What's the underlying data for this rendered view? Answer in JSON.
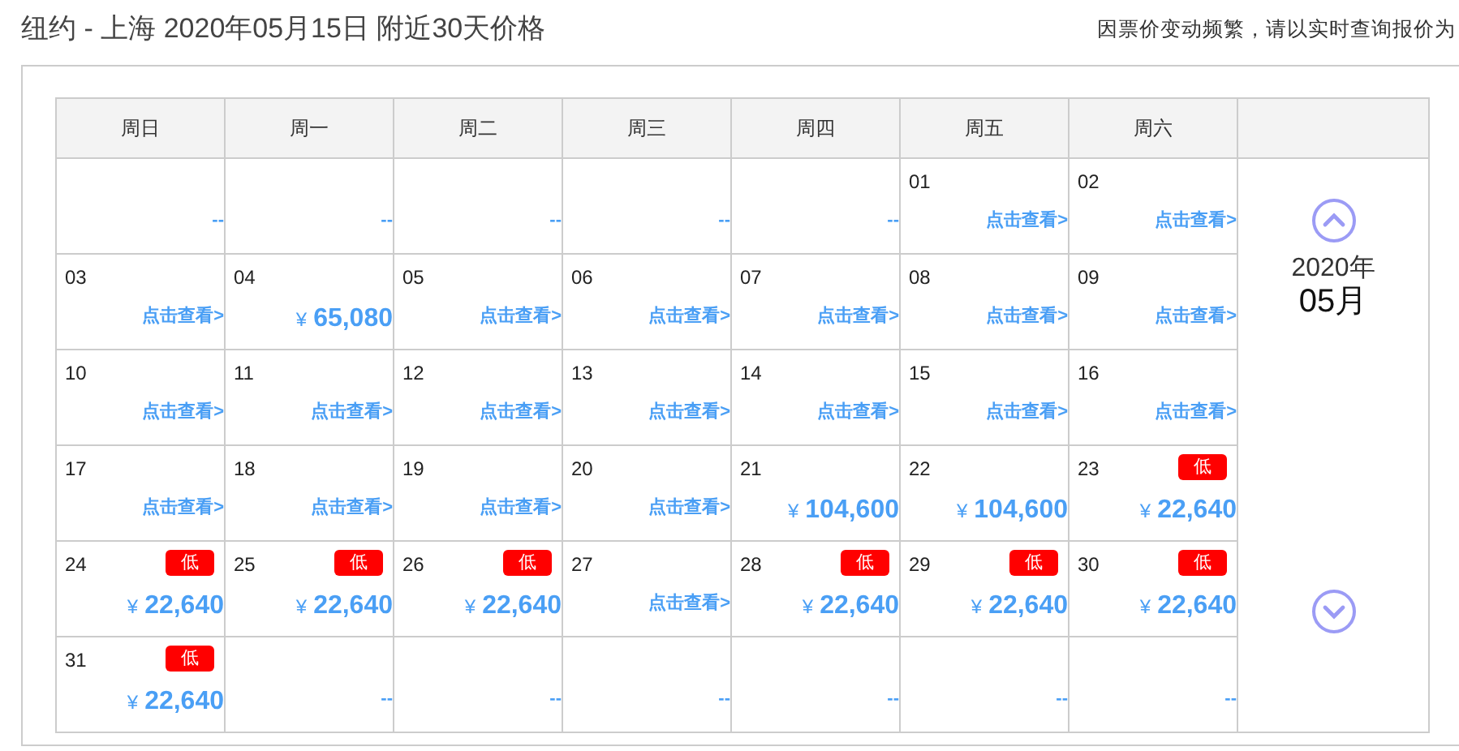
{
  "header": {
    "title": "纽约 - 上海 2020年05月15日  附近30天价格",
    "notice": "因票价变动频繁，请以实时查询报价为"
  },
  "weekdays": [
    "周日",
    "周一",
    "周二",
    "周三",
    "周四",
    "周五",
    "周六"
  ],
  "weeks": [
    [
      {
        "kind": "empty",
        "text": "--"
      },
      {
        "kind": "empty",
        "text": "--"
      },
      {
        "kind": "empty",
        "text": "--"
      },
      {
        "kind": "empty",
        "text": "--"
      },
      {
        "kind": "empty",
        "text": "--"
      },
      {
        "kind": "view",
        "date": "01",
        "link": "点击查看>"
      },
      {
        "kind": "view",
        "date": "02",
        "link": "点击查看>"
      }
    ],
    [
      {
        "kind": "view",
        "date": "03",
        "link": "点击查看>"
      },
      {
        "kind": "price",
        "date": "04",
        "currency": "¥",
        "price": "65,080"
      },
      {
        "kind": "view",
        "date": "05",
        "link": "点击查看>"
      },
      {
        "kind": "view",
        "date": "06",
        "link": "点击查看>"
      },
      {
        "kind": "view",
        "date": "07",
        "link": "点击查看>"
      },
      {
        "kind": "view",
        "date": "08",
        "link": "点击查看>"
      },
      {
        "kind": "view",
        "date": "09",
        "link": "点击查看>"
      }
    ],
    [
      {
        "kind": "view",
        "date": "10",
        "link": "点击查看>"
      },
      {
        "kind": "view",
        "date": "11",
        "link": "点击查看>"
      },
      {
        "kind": "view",
        "date": "12",
        "link": "点击查看>"
      },
      {
        "kind": "view",
        "date": "13",
        "link": "点击查看>"
      },
      {
        "kind": "view",
        "date": "14",
        "link": "点击查看>"
      },
      {
        "kind": "view",
        "date": "15",
        "link": "点击查看>"
      },
      {
        "kind": "view",
        "date": "16",
        "link": "点击查看>"
      }
    ],
    [
      {
        "kind": "view",
        "date": "17",
        "link": "点击查看>"
      },
      {
        "kind": "view",
        "date": "18",
        "link": "点击查看>"
      },
      {
        "kind": "view",
        "date": "19",
        "link": "点击查看>"
      },
      {
        "kind": "view",
        "date": "20",
        "link": "点击查看>"
      },
      {
        "kind": "price",
        "date": "21",
        "currency": "¥",
        "price": "104,600"
      },
      {
        "kind": "price",
        "date": "22",
        "currency": "¥",
        "price": "104,600"
      },
      {
        "kind": "price",
        "date": "23",
        "currency": "¥",
        "price": "22,640",
        "badge": "低"
      }
    ],
    [
      {
        "kind": "price",
        "date": "24",
        "currency": "¥",
        "price": "22,640",
        "badge": "低"
      },
      {
        "kind": "price",
        "date": "25",
        "currency": "¥",
        "price": "22,640",
        "badge": "低"
      },
      {
        "kind": "price",
        "date": "26",
        "currency": "¥",
        "price": "22,640",
        "badge": "低"
      },
      {
        "kind": "view",
        "date": "27",
        "link": "点击查看>"
      },
      {
        "kind": "price",
        "date": "28",
        "currency": "¥",
        "price": "22,640",
        "badge": "低"
      },
      {
        "kind": "price",
        "date": "29",
        "currency": "¥",
        "price": "22,640",
        "badge": "低"
      },
      {
        "kind": "price",
        "date": "30",
        "currency": "¥",
        "price": "22,640",
        "badge": "低"
      }
    ],
    [
      {
        "kind": "price",
        "date": "31",
        "currency": "¥",
        "price": "22,640",
        "badge": "低"
      },
      {
        "kind": "empty",
        "text": "--"
      },
      {
        "kind": "empty",
        "text": "--"
      },
      {
        "kind": "empty",
        "text": "--"
      },
      {
        "kind": "empty",
        "text": "--"
      },
      {
        "kind": "empty",
        "text": "--"
      },
      {
        "kind": "empty",
        "text": "--"
      }
    ]
  ],
  "month_nav": {
    "year": "2020年",
    "month": "05月"
  }
}
